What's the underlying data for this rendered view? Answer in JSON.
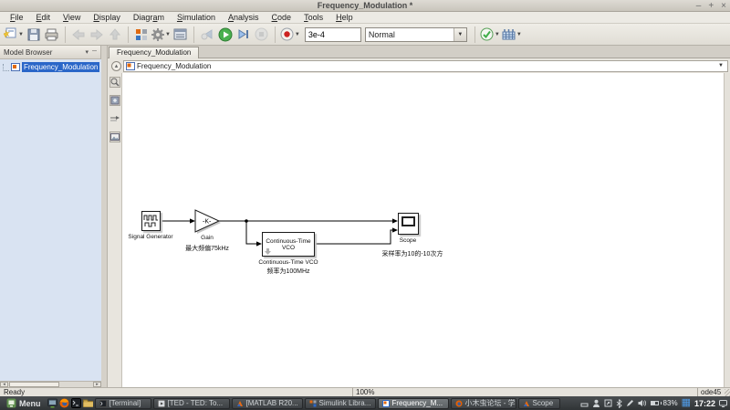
{
  "window": {
    "title": "Frequency_Modulation *",
    "minimize": "–",
    "maximize": "+",
    "close": "×"
  },
  "menu": {
    "items": [
      {
        "pre": "",
        "key": "F",
        "post": "ile"
      },
      {
        "pre": "",
        "key": "E",
        "post": "dit"
      },
      {
        "pre": "",
        "key": "V",
        "post": "iew"
      },
      {
        "pre": "",
        "key": "D",
        "post": "isplay"
      },
      {
        "pre": "Diagr",
        "key": "a",
        "post": "m"
      },
      {
        "pre": "",
        "key": "S",
        "post": "imulation"
      },
      {
        "pre": "",
        "key": "A",
        "post": "nalysis"
      },
      {
        "pre": "",
        "key": "C",
        "post": "ode"
      },
      {
        "pre": "",
        "key": "T",
        "post": "ools"
      },
      {
        "pre": "",
        "key": "H",
        "post": "elp"
      }
    ]
  },
  "toolbar": {
    "sim_stop_time": "3e-4",
    "sim_mode": "Normal"
  },
  "model_browser": {
    "title": "Model Browser",
    "item": "Frequency_Modulation"
  },
  "editor": {
    "tab": "Frequency_Modulation",
    "breadcrumb": "Frequency_Modulation"
  },
  "diagram": {
    "signal_generator": {
      "label": "Signal Generator"
    },
    "gain": {
      "inner": "-K-",
      "label": "Gain",
      "annotation": "最大频偏75kHz"
    },
    "vco": {
      "line1": "Continuous-Time",
      "line2": "VCO",
      "label": "Continuous-Time VCO",
      "annotation": "频率为100MHz"
    },
    "scope": {
      "label": "Scope",
      "annotation": "采样率为10的-10次方"
    }
  },
  "statusbar": {
    "status": "Ready",
    "zoom": "100%",
    "solver": "ode45"
  },
  "taskbar": {
    "menu": "Menu",
    "windows": [
      {
        "label": "[Terminal]"
      },
      {
        "label": "[TED - TED: To..."
      },
      {
        "label": "[MATLAB R20..."
      },
      {
        "label": "Simulink Libra..."
      },
      {
        "label": "Frequency_M...",
        "active": true
      },
      {
        "label": "小木虫论坛 - 学..."
      },
      {
        "label": "Scope"
      }
    ],
    "battery": "83%",
    "time": "17:22",
    "tray_icons": [
      "window",
      "user",
      "clipboard",
      "bluetooth",
      "edit",
      "volume",
      "battery",
      "workspaces",
      "clock",
      "display"
    ]
  },
  "colors": {
    "selection_blue": "#2a66c8",
    "run_green": "#3fae49",
    "record_red": "#cc2222",
    "taskbar_bg": "#35393c",
    "canvas_white": "#ffffff",
    "browser_bg": "#d9e3f2",
    "workspace_blue": "#4f9ce8"
  }
}
